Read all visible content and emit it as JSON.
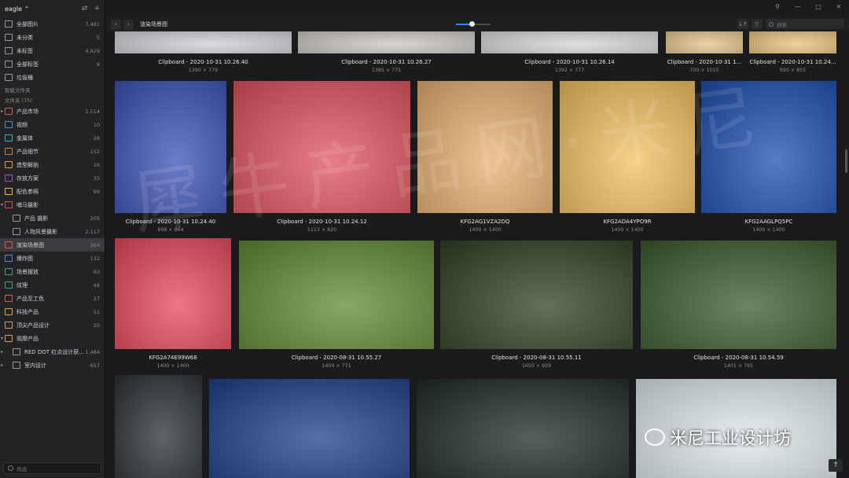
{
  "library": {
    "name": "eagle"
  },
  "window": {
    "minimize": "—",
    "maximize": "□",
    "close": "✕",
    "pin": "⚲"
  },
  "sidebar": {
    "fixed_items": [
      {
        "label": "全部图片",
        "count": "7,481",
        "icon": "images-icon"
      },
      {
        "label": "未分类",
        "count": "5",
        "icon": "uncategorized-icon"
      },
      {
        "label": "未标签",
        "count": "4,629",
        "icon": "untagged-icon"
      },
      {
        "label": "全部标签",
        "count": "9",
        "icon": "tags-icon"
      },
      {
        "label": "垃圾桶",
        "count": "",
        "icon": "trash-icon"
      }
    ],
    "smart_folders_label": "智能文件夹",
    "folders_label": "文件夹 (75)",
    "folders": [
      {
        "label": "产品市场",
        "count": "1,514",
        "color": "#e05a4a",
        "caret": "▸"
      },
      {
        "label": "视频",
        "count": "10",
        "color": "#4a8fe0",
        "caret": ""
      },
      {
        "label": "金属体",
        "count": "28",
        "color": "#3cb0c8",
        "caret": ""
      },
      {
        "label": "产品细节",
        "count": "152",
        "color": "#e07a3a",
        "caret": ""
      },
      {
        "label": "造型解剖",
        "count": "16",
        "color": "#e0a03a",
        "caret": ""
      },
      {
        "label": "存放方案",
        "count": "33",
        "color": "#8a5ae0",
        "caret": ""
      },
      {
        "label": "配色参照",
        "count": "99",
        "color": "#e0c03a",
        "caret": ""
      },
      {
        "label": "哺马摄影",
        "count": "",
        "color": "#e04a5a",
        "caret": "▾"
      },
      {
        "label": "产品 摄影",
        "count": "205",
        "color": "#9a9a9e",
        "caret": "",
        "child": true
      },
      {
        "label": "人物风景摄影",
        "count": "2,117",
        "color": "#9a9a9e",
        "caret": "",
        "child": true
      },
      {
        "label": "渲染场景图",
        "count": "264",
        "color": "#e05a4a",
        "caret": "",
        "active": true
      },
      {
        "label": "爆炸图",
        "count": "132",
        "color": "#4a8fe0",
        "caret": ""
      },
      {
        "label": "场景摆放",
        "count": "83",
        "color": "#3ca878",
        "caret": ""
      },
      {
        "label": "纹理",
        "count": "46",
        "color": "#3ca878",
        "caret": ""
      },
      {
        "label": "产品至工色",
        "count": "27",
        "color": "#e05a4a",
        "caret": ""
      },
      {
        "label": "科技产品",
        "count": "11",
        "color": "#e0a03a",
        "caret": ""
      },
      {
        "label": "顶尖产品设计",
        "count": "20",
        "color": "#e0a03a",
        "caret": ""
      },
      {
        "label": "观摩产品",
        "count": "",
        "color": "#e0a03a",
        "caret": "▾"
      },
      {
        "label": "RED DOT 红点设计获...",
        "count": "1,484",
        "color": "#9a9a9e",
        "caret": "▸",
        "child": true
      },
      {
        "label": "室内设计",
        "count": "657",
        "color": "#9a9a9e",
        "caret": "▸",
        "child": true
      }
    ],
    "filter_placeholder": "筛选"
  },
  "toolbar": {
    "back": "‹",
    "forward": "›",
    "title": "渲染场景图",
    "zoom_fraction": 0.45,
    "sort_icon": "↓↑",
    "filter_icon": "▽",
    "search_placeholder": "搜索"
  },
  "items": [
    {
      "name": "Clipboard - 2020-10-31 10.26.40",
      "dims": "1390 × 779",
      "bg": "#cfcfd4"
    },
    {
      "name": "Clipboard - 2020-10-31 10.26.27",
      "dims": "1385 × 775",
      "bg": "#c9c6c2"
    },
    {
      "name": "Clipboard - 2020-10-31 10.26.14",
      "dims": "1392 × 777",
      "bg": "#d6d6d8"
    },
    {
      "name": "Clipboard - 2020-10-31 1...",
      "dims": "700 × 1015",
      "bg": "#e3c48a"
    },
    {
      "name": "Clipboard - 2020-10-31 10.24...",
      "dims": "690 × 855",
      "bg": "#e9c27a"
    },
    {
      "name": "Clipboard - 2020-10-31 10.24.40",
      "dims": "699 × 864",
      "bg": "#3b52b6"
    },
    {
      "name": "Clipboard - 2020-10-31 10.24.12",
      "dims": "1113 × 820",
      "bg": "#e0525c"
    },
    {
      "name": "KFG2AG1VZA2DQ",
      "dims": "1400 × 1400",
      "bg": "#e8b070"
    },
    {
      "name": "KFG2ADA4YPO9R",
      "dims": "1400 × 1400",
      "bg": "#f2c060"
    },
    {
      "name": "KFG2AAGLPQ5PC",
      "dims": "1400 × 1400",
      "bg": "#1d4fb0"
    },
    {
      "name": "KFG2A74E99W68",
      "dims": "1400 × 1400",
      "bg": "#e8485a"
    },
    {
      "name": "Clipboard - 2020-08-31 10.55.27",
      "dims": "1404 × 771",
      "bg": "#5e8a34"
    },
    {
      "name": "Clipboard - 2020-08-31 10.55.11",
      "dims": "1650 × 929",
      "bg": "#2f4023"
    },
    {
      "name": "Clipboard - 2020-08-31 10.54.59",
      "dims": "1401 × 765",
      "bg": "#3d5a2b"
    },
    {
      "name": "",
      "dims": "",
      "bg": "#2a3036"
    },
    {
      "name": "",
      "dims": "",
      "bg": "#1e3f8a"
    },
    {
      "name": "",
      "dims": "",
      "bg": "#1f2a26"
    },
    {
      "name": "",
      "dims": "",
      "bg": "#dfe8ea"
    }
  ],
  "watermark": {
    "text": "犀牛产品网·米尼",
    "brand": "米尼工业设计坊"
  },
  "back_to_top": "↑"
}
